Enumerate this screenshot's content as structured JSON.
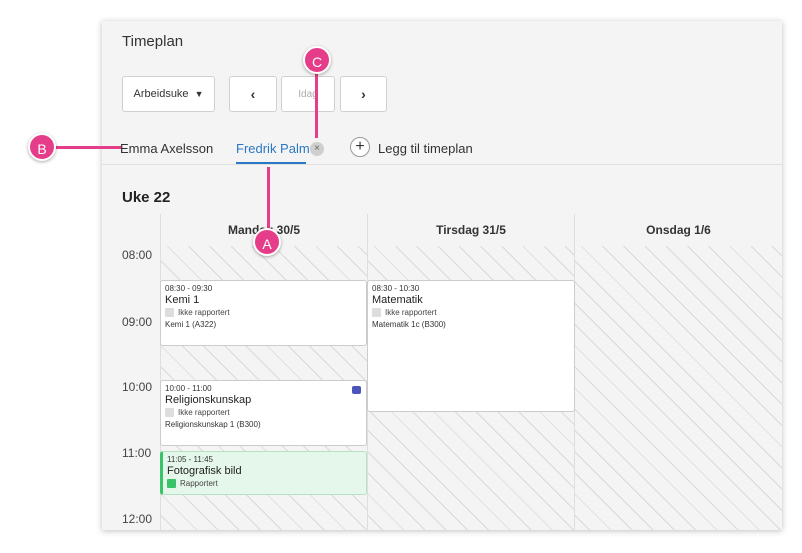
{
  "page_title": "Timeplan",
  "toolbar": {
    "view_select": "Arbeidsuke",
    "prev_label": "‹",
    "today_label": "Idag",
    "next_label": "›"
  },
  "tabs": [
    {
      "label": "Emma Axelsson"
    },
    {
      "label": "Fredrik Palm",
      "close": "×"
    }
  ],
  "add_schedule": {
    "icon": "+",
    "label": "Legg til timeplan"
  },
  "week_label": "Uke 22",
  "days": [
    {
      "label": "Mandag 30/5"
    },
    {
      "label": "Tirsdag 31/5"
    },
    {
      "label": "Onsdag 1/6"
    }
  ],
  "times": [
    "08:00",
    "09:00",
    "10:00",
    "11:00",
    "12:00"
  ],
  "events": [
    {
      "time": "08:30 - 09:30",
      "name": "Kemi 1",
      "status": "Ikke rapportert",
      "room": "Kemi 1 (A322)"
    },
    {
      "time": "10:00 - 11:00",
      "name": "Religionskunskap",
      "status": "Ikke rapportert",
      "room": "Religionskunskap 1 (B300)",
      "icon": "teams-icon"
    },
    {
      "time": "11:05 - 11:45",
      "name": "Fotografisk bild",
      "status": "Rapportert",
      "status_color": "#3ac46a"
    },
    {
      "time": "08:30 - 10:30",
      "name": "Matematik",
      "status": "Ikke rapportert",
      "room": "Matematik 1c (B300)"
    }
  ],
  "markers": {
    "a": "A",
    "b": "B",
    "c": "C",
    "color": "#e63d8a"
  },
  "accent_color": "#2a78c5"
}
